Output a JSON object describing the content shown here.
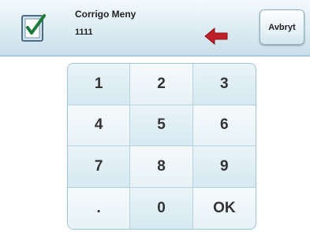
{
  "header": {
    "title": "Corrigo Meny",
    "input_value": "1111",
    "cancel_label": "Avbryt",
    "app_icon": "checkbox-clipboard-icon",
    "backspace_icon": "left-arrow-icon"
  },
  "keypad": {
    "keys": [
      "1",
      "2",
      "3",
      "4",
      "5",
      "6",
      "7",
      "8",
      "9",
      ".",
      "0",
      "OK"
    ]
  },
  "colors": {
    "header_bg": "#dcecf3",
    "key_bg": "#d6e9f1",
    "arrow": "#c0202a"
  }
}
